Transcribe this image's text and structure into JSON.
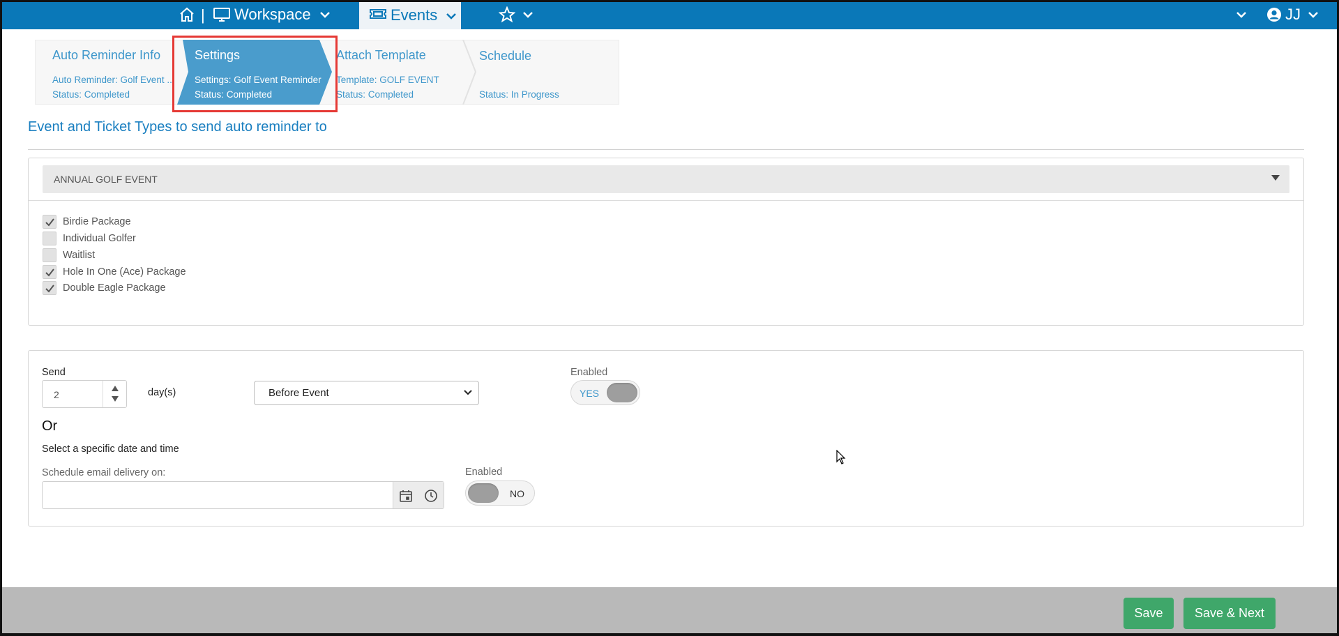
{
  "nav": {
    "workspace_label": "Workspace",
    "events_label": "Events",
    "separator": "|",
    "user_initials": "JJ",
    "icons": [
      "home-icon",
      "monitor-icon",
      "ticket-icon",
      "star-icon",
      "user-circle-icon",
      "chevron-down-icon"
    ]
  },
  "steps": [
    {
      "title": "Auto Reminder Info",
      "line1": "Auto Reminder: Golf Event ...",
      "line2": "Status: Completed",
      "active": false
    },
    {
      "title": "Settings",
      "line1": "Settings: Golf Event Reminder",
      "line2": "Status: Completed",
      "active": true
    },
    {
      "title": "Attach Template",
      "line1": "Template: GOLF EVENT",
      "line2": "Status: Completed",
      "active": false
    },
    {
      "title": "Schedule",
      "line1": "",
      "line2": "Status: In Progress",
      "active": false
    }
  ],
  "section_title": "Event and Ticket Types to send auto reminder to",
  "event_select": {
    "value": "ANNUAL GOLF EVENT"
  },
  "ticket_types": [
    {
      "label": "Birdie Package",
      "checked": true
    },
    {
      "label": "Individual Golfer",
      "checked": false
    },
    {
      "label": "Waitlist",
      "checked": false
    },
    {
      "label": "Hole In One (Ace) Package",
      "checked": true
    },
    {
      "label": "Double Eagle Package",
      "checked": true
    }
  ],
  "send": {
    "label": "Send",
    "days_value": "2",
    "days_unit": "day(s)",
    "timing": "Before Event",
    "enabled_label": "Enabled",
    "enabled_toggle": "YES"
  },
  "or_label": "Or",
  "specific": {
    "heading": "Select a specific date and time",
    "delivery_label": "Schedule email delivery on:",
    "delivery_value": "",
    "enabled_label": "Enabled",
    "enabled_toggle": "NO"
  },
  "footer": {
    "save_label": "Save",
    "save_next_label": "Save & Next"
  },
  "colors": {
    "nav_bg": "#0a78b8",
    "active_step": "#3f97cb",
    "highlight": "#e53935",
    "button_green": "#3fa76a"
  }
}
